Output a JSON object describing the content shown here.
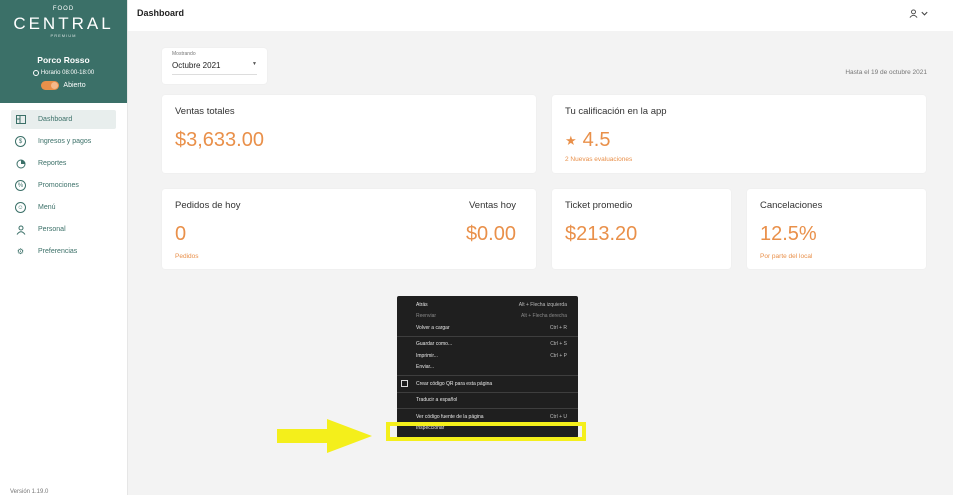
{
  "brand": {
    "small": "FOOD",
    "name": "CENTRAL",
    "tagline": "PREMIUM"
  },
  "store": {
    "name": "Porco Rosso",
    "hours": "Horario 08:00-18:00",
    "status": "Abierto"
  },
  "nav": {
    "items": [
      {
        "label": "Dashboard",
        "icon": "dashboard-icon",
        "active": true
      },
      {
        "label": "Ingresos y pagos",
        "icon": "dollar-icon"
      },
      {
        "label": "Reportes",
        "icon": "report-icon"
      },
      {
        "label": "Promociones",
        "icon": "percent-icon"
      },
      {
        "label": "Menú",
        "icon": "menu-icon"
      },
      {
        "label": "Personal",
        "icon": "people-icon"
      },
      {
        "label": "Preferencias",
        "icon": "gear-icon"
      }
    ]
  },
  "version": "Versión 1.19.0",
  "header": {
    "title": "Dashboard",
    "user_icon": "user-icon",
    "chevron": "chevron-down-icon"
  },
  "filter": {
    "label": "Mostrando",
    "value": "Octubre 2021"
  },
  "range_note": "Hasta el 19 de octubre 2021",
  "cards": {
    "total_sales": {
      "title": "Ventas totales",
      "value": "$3,633.00"
    },
    "rating": {
      "title": "Tu calificación en la app",
      "value": "4.5",
      "sub": "2 Nuevas evaluaciones"
    },
    "orders_today": {
      "title": "Pedidos de hoy",
      "value": "0",
      "sub": "Pedidos"
    },
    "sales_today": {
      "title": "Ventas hoy",
      "value": "$0.00"
    },
    "avg_ticket": {
      "title": "Ticket promedio",
      "value": "$213.20"
    },
    "cancellations": {
      "title": "Cancelaciones",
      "value": "12.5%",
      "sub": "Por parte del local"
    }
  },
  "context_menu": {
    "back": {
      "label": "Atrás",
      "shortcut": "Alt + Flecha izquierda"
    },
    "forward": {
      "label": "Reenviar",
      "shortcut": "Alt + Flecha derecha"
    },
    "reload": {
      "label": "Volver a cargar",
      "shortcut": "Ctrl + R"
    },
    "save": {
      "label": "Guardar como...",
      "shortcut": "Ctrl + S"
    },
    "print": {
      "label": "Imprimir...",
      "shortcut": "Ctrl + P"
    },
    "send": {
      "label": "Enviar..."
    },
    "qr": {
      "label": "Crear código QR para esta página"
    },
    "translate": {
      "label": "Traducir a español"
    },
    "source": {
      "label": "Ver código fuente de la página",
      "shortcut": "Ctrl + U"
    },
    "inspect": {
      "label": "Inspeccionar"
    }
  },
  "colors": {
    "brand": "#3b7068",
    "accent": "#e9904a",
    "highlight": "#f4ef1b"
  }
}
